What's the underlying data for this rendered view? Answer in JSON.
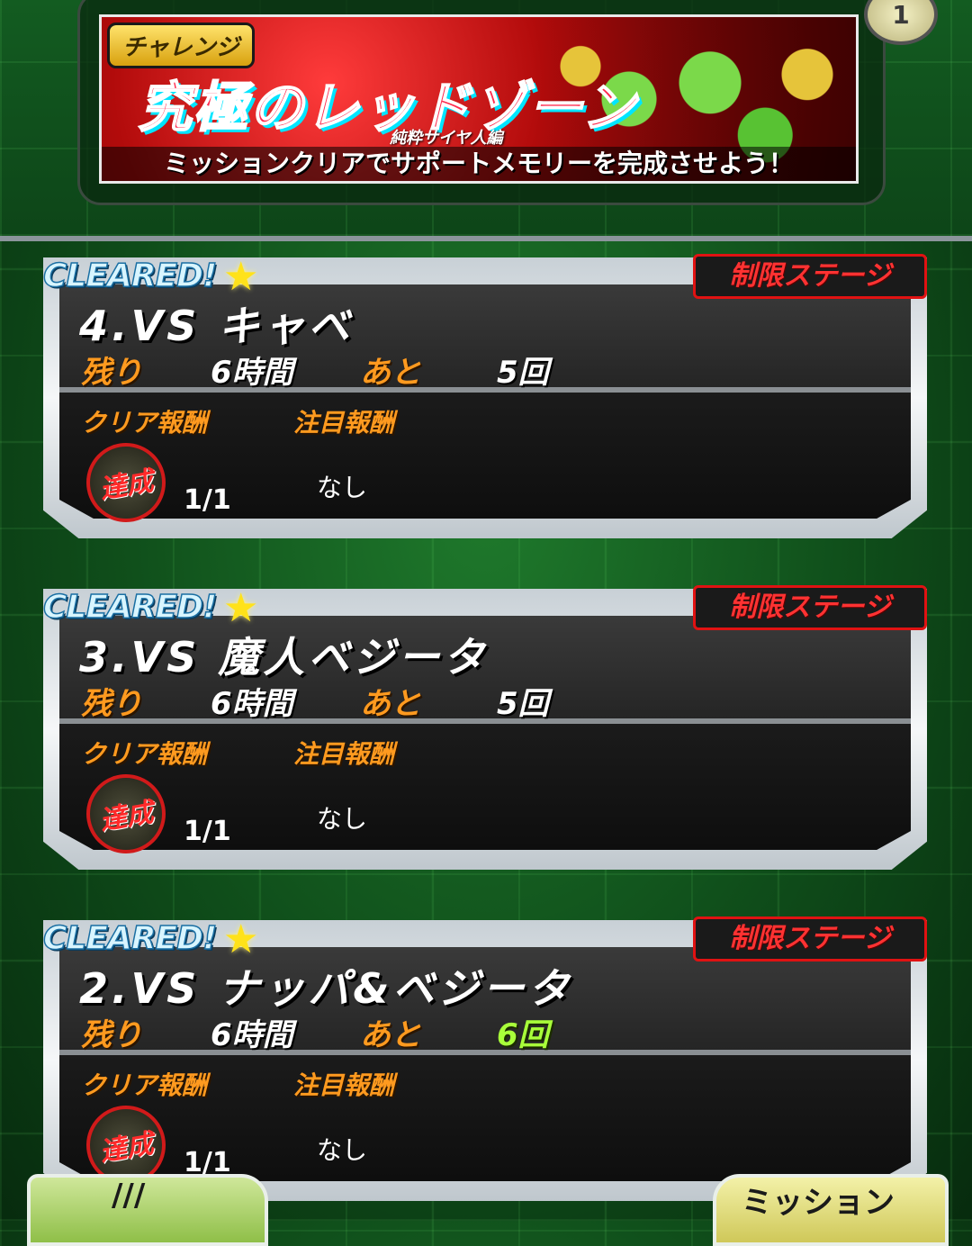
{
  "header": {
    "challenge_tag": "チャレンジ",
    "banner_title": "究極のレッドゾーン",
    "banner_subtitle": "純粋サイヤ人編",
    "banner_caption": "ミッションクリアでサポートメモリーを完成させよう！",
    "corner_badge": "1"
  },
  "cards": [
    {
      "cleared": "CLEARED!",
      "restrict": "制限ステージ",
      "title": "4.VS キャベ",
      "remain_label": "残り",
      "remain_value": "6時間",
      "tries_label": "あと",
      "tries_value": "5回",
      "clear_reward_label": "クリア報酬",
      "focus_reward_label": "注目報酬",
      "achieved": "達成",
      "count": "1/1",
      "focus_reward_value": "なし"
    },
    {
      "cleared": "CLEARED!",
      "restrict": "制限ステージ",
      "title": "3.VS 魔人ベジータ",
      "remain_label": "残り",
      "remain_value": "6時間",
      "tries_label": "あと",
      "tries_value": "5回",
      "clear_reward_label": "クリア報酬",
      "focus_reward_label": "注目報酬",
      "achieved": "達成",
      "count": "1/1",
      "focus_reward_value": "なし"
    },
    {
      "cleared": "CLEARED!",
      "restrict": "制限ステージ",
      "title": "2.VS ナッパ&ベジータ",
      "remain_label": "残り",
      "remain_value": "6時間",
      "tries_label": "あと",
      "tries_value": "6回",
      "clear_reward_label": "クリア報酬",
      "focus_reward_label": "注目報酬",
      "achieved": "達成",
      "count": "1/1",
      "focus_reward_value": "なし"
    }
  ],
  "bottom_nav": {
    "left_label": "///",
    "right_label": "ミッション"
  },
  "colors": {
    "background": "#0f4d1a",
    "cleared_text": "#d8f5ff",
    "orange_label": "#ff9a1f",
    "restrict_red": "#e01212",
    "tries_highlight_green": "#a8ff3a"
  }
}
